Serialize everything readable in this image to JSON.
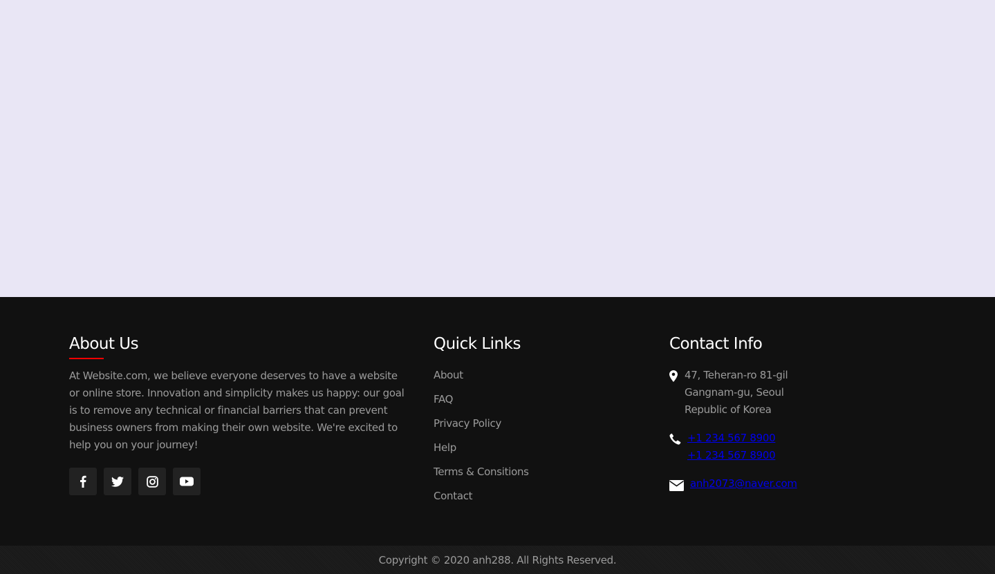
{
  "about": {
    "title": "About Us",
    "text": "At Website.com, we believe everyone deserves to have a website or online store. Innovation and simplicity makes us happy: our goal is to remove any technical or financial barriers that can prevent business owners from making their own website. We're excited to help you on your journey!",
    "accent_color": "#ff0000",
    "social": [
      "facebook-icon",
      "twitter-icon",
      "instagram-icon",
      "youtube-icon"
    ]
  },
  "quick_links": {
    "title": "Quick Links",
    "items": [
      "About",
      "FAQ",
      "Privacy Policy",
      "Help",
      "Terms & Consitions",
      "Contact"
    ]
  },
  "contact": {
    "title": "Contact Info",
    "address": [
      "47, Teheran-ro 81-gil",
      "Gangnam-gu, Seoul",
      "Republic of Korea"
    ],
    "phones": [
      "+1 234 567 8900",
      "+1 234 567 8900"
    ],
    "email": "anh2073@naver.com"
  },
  "copyright": "Copyright © 2020 anh288. All Rights Reserved."
}
